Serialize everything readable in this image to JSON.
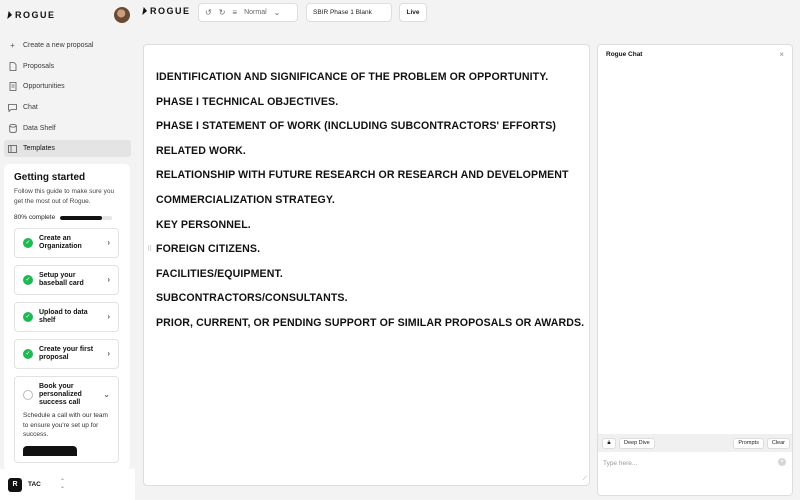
{
  "brand": {
    "name": "ROGUE"
  },
  "sidebar": {
    "items": [
      {
        "label": "Create a new proposal",
        "icon": "plus-icon"
      },
      {
        "label": "Proposals",
        "icon": "file-icon"
      },
      {
        "label": "Opportunities",
        "icon": "document-icon"
      },
      {
        "label": "Chat",
        "icon": "chat-icon"
      },
      {
        "label": "Data Shelf",
        "icon": "database-icon"
      },
      {
        "label": "Templates",
        "icon": "template-icon",
        "active": true
      }
    ]
  },
  "getting_started": {
    "title": "Getting started",
    "subtitle": "Follow this guide to make sure you get the most out of Rogue.",
    "progress_label": "80% complete",
    "progress": 0.8,
    "steps": [
      {
        "label": "Create an Organization",
        "done": true
      },
      {
        "label": "Setup your baseball card",
        "done": true
      },
      {
        "label": "Upload to data shelf",
        "done": true
      },
      {
        "label": "Create your first proposal",
        "done": true
      },
      {
        "label": "Book your personalized success call",
        "done": false,
        "description": "Schedule a call with our team to ensure you're set up for success."
      }
    ]
  },
  "org": {
    "badge": "R",
    "name": "TAC"
  },
  "toolbar": {
    "style_label": "Normal",
    "document_name": "SBIR Phase 1 Blank",
    "live_label": "Live"
  },
  "editor": {
    "headings": [
      "IDENTIFICATION AND SIGNIFICANCE OF THE PROBLEM OR OPPORTUNITY.",
      "PHASE I TECHNICAL OBJECTIVES.",
      "PHASE I STATEMENT OF WORK (INCLUDING SUBCONTRACTORS' EFFORTS)",
      "RELATED WORK.",
      "RELATIONSHIP WITH FUTURE RESEARCH OR RESEARCH AND DEVELOPMENT",
      "COMMERCIALIZATION STRATEGY.",
      "KEY PERSONNEL.",
      "FOREIGN CITIZENS.",
      "FACILITIES/EQUIPMENT.",
      "SUBCONTRACTORS/CONSULTANTS.",
      "PRIOR, CURRENT, OR PENDING SUPPORT OF SIMILAR PROPOSALS OR AWARDS."
    ]
  },
  "chat": {
    "title": "Rogue Chat",
    "deep_dive_label": "Deep Dive",
    "prompts_label": "Prompts",
    "clear_label": "Clear",
    "input_placeholder": "Type here..."
  }
}
